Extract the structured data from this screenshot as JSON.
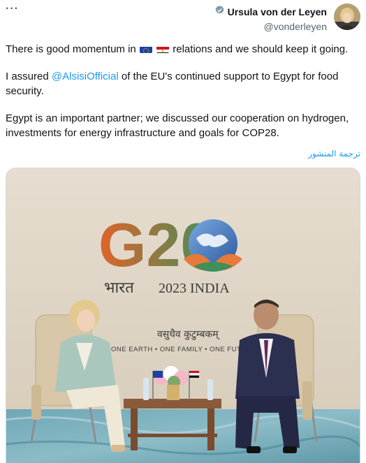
{
  "header": {
    "more_label": "···",
    "author_name": "Ursula von der Leyen",
    "author_handle": "@vonderleyen",
    "verified_color": "#829aab"
  },
  "tweet": {
    "line1_before": "There is good momentum in ",
    "line1_after": " relations and we should keep it going.",
    "para2_before": "I assured ",
    "para2_mention": "@AlsisiOfficial",
    "para2_after": " of the EU's continued support to Egypt for food security.",
    "para3": "Egypt is an important partner; we discussed our cooperation on hydrogen, investments for energy infrastructure and goals for COP28.",
    "flags": [
      "eu-flag-icon",
      "egypt-flag-icon"
    ]
  },
  "translate_label": "ترجمة المنشور",
  "photo": {
    "logo_text": "G20",
    "hindi_word": "भारत",
    "year_country": "2023 INDIA",
    "motto_hindi": "वसुधैव कुटुम्बकम्",
    "motto_english": "ONE EARTH • ONE FAMILY • ONE FUTURE"
  },
  "colors": {
    "accent": "#1d9bf0",
    "text": "#0f1419",
    "muted": "#536471",
    "backdrop": "#ddd3c3"
  }
}
